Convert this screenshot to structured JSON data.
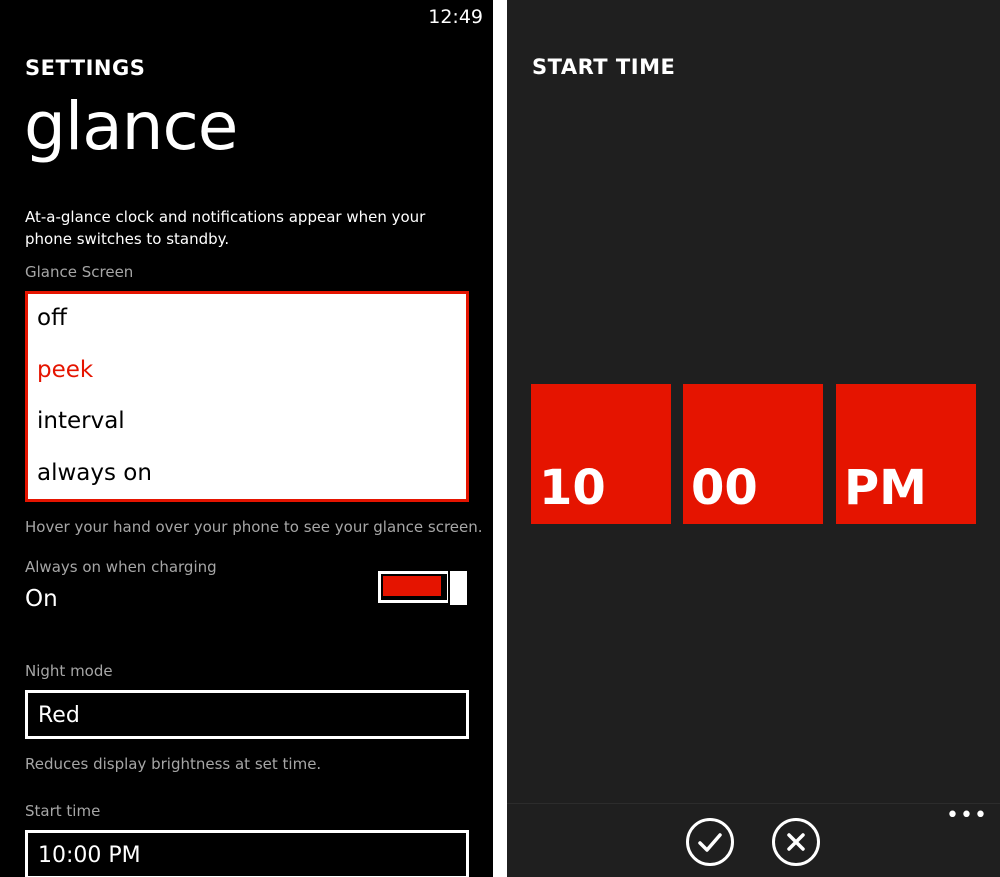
{
  "status_bar": {
    "time": "12:49"
  },
  "settings": {
    "header": "SETTINGS",
    "title": "glance",
    "description": "At-a-glance clock and notifications appear when your phone switches to standby.",
    "glance_screen": {
      "label": "Glance Screen",
      "options": [
        "off",
        "peek",
        "interval",
        "always on"
      ],
      "selected": "peek",
      "hint": "Hover your hand over your phone to see your glance screen."
    },
    "always_on_charging": {
      "label": "Always on when charging",
      "value": "On",
      "checked": true
    },
    "night_mode": {
      "label": "Night mode",
      "value": "Red",
      "hint": "Reduces display brightness at set time."
    },
    "start_time": {
      "label": "Start time",
      "value": "10:00 PM"
    }
  },
  "time_picker": {
    "title": "START TIME",
    "hour": "10",
    "minute": "00",
    "period": "PM",
    "more_label": "•••"
  },
  "colors": {
    "accent": "#e51400",
    "background": "#000000",
    "picker_background": "#1f1f1f"
  },
  "icons": {
    "confirm": "check-circle-icon",
    "cancel": "close-circle-icon",
    "more": "ellipsis-icon"
  }
}
